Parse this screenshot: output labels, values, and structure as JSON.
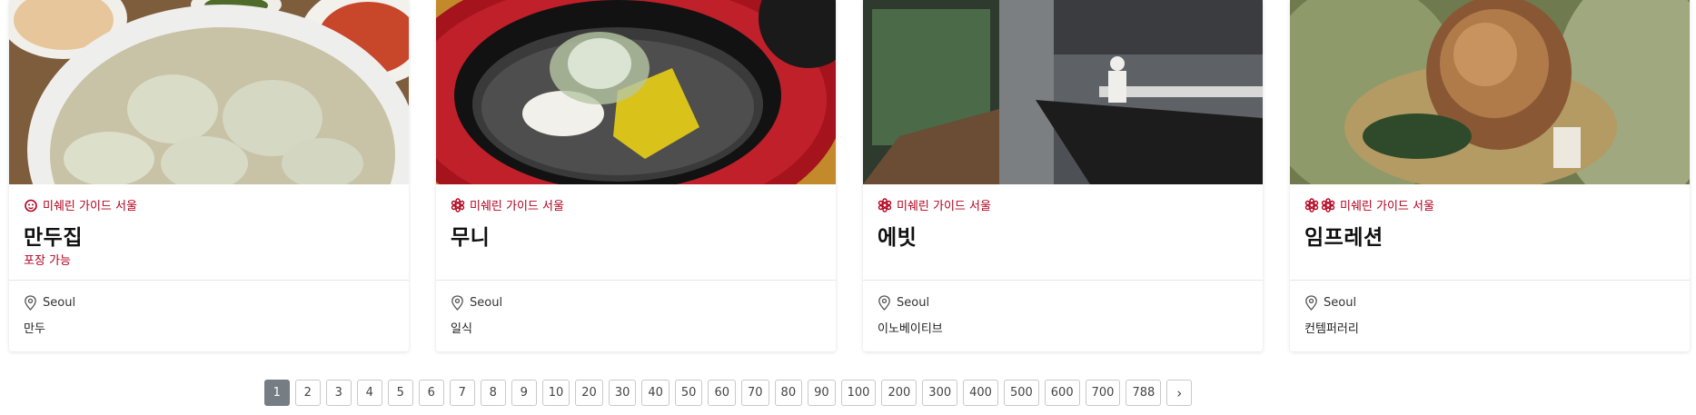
{
  "cards": [
    {
      "guide_label": "미쉐린 가이드 서울",
      "distinction": "bib-gourmand",
      "name": "만두집",
      "takeout": "포장 가능",
      "location": "Seoul",
      "cuisine": "만두",
      "photo": "mandu-soup"
    },
    {
      "guide_label": "미쉐린 가이드 서울",
      "distinction": "one-star",
      "name": "무니",
      "takeout": "",
      "location": "Seoul",
      "cuisine": "일식",
      "photo": "japanese-dish"
    },
    {
      "guide_label": "미쉐린 가이드 서울",
      "distinction": "one-star",
      "name": "에빗",
      "takeout": "",
      "location": "Seoul",
      "cuisine": "이노베이티브",
      "photo": "restaurant-interior"
    },
    {
      "guide_label": "미쉐린 가이드 서울",
      "distinction": "two-stars",
      "name": "임프레션",
      "takeout": "",
      "location": "Seoul",
      "cuisine": "컨템퍼러리",
      "photo": "roast-chicken"
    }
  ],
  "pagination": {
    "current": "1",
    "pages": [
      "1",
      "2",
      "3",
      "4",
      "5",
      "6",
      "7",
      "8",
      "9",
      "10",
      "20",
      "30",
      "40",
      "50",
      "60",
      "70",
      "80",
      "90",
      "100",
      "200",
      "300",
      "400",
      "500",
      "600",
      "700",
      "788"
    ],
    "next_label": "›"
  },
  "colors": {
    "michelin_red": "#b3001d",
    "active_page": "#777d84"
  }
}
